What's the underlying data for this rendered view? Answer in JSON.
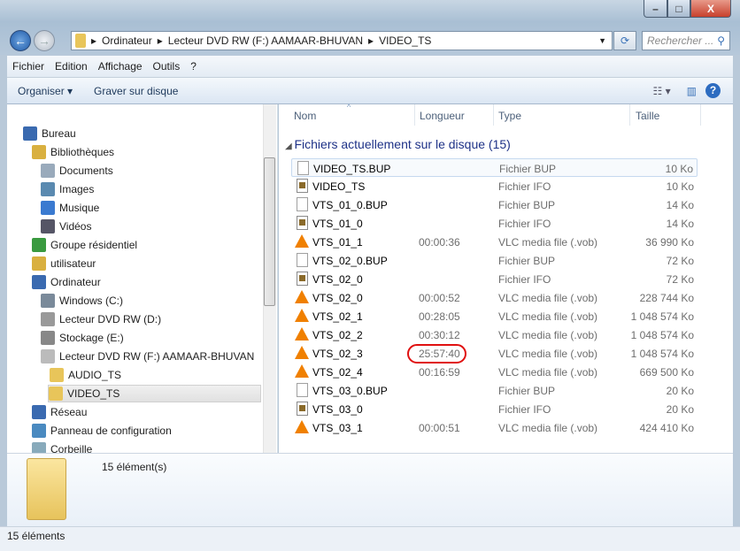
{
  "window": {
    "min": "–",
    "max": "□",
    "close": "X"
  },
  "address": {
    "crumbs": [
      "Ordinateur",
      "Lecteur DVD RW (F:) AAMAAR-BHUVAN",
      "VIDEO_TS"
    ],
    "search_placeholder": "Rechercher ..."
  },
  "menu": [
    "Fichier",
    "Edition",
    "Affichage",
    "Outils",
    "?"
  ],
  "toolbar": {
    "organize": "Organiser ▾",
    "burn": "Graver sur disque"
  },
  "nav": [
    {
      "label": "Bureau",
      "indent": 0,
      "color": "#3a6ab0"
    },
    {
      "label": "Bibliothèques",
      "indent": 1,
      "color": "#d9b040"
    },
    {
      "label": "Documents",
      "indent": 2,
      "color": "#9ab"
    },
    {
      "label": "Images",
      "indent": 2,
      "color": "#5a8ab0"
    },
    {
      "label": "Musique",
      "indent": 2,
      "color": "#3a7ad0"
    },
    {
      "label": "Vidéos",
      "indent": 2,
      "color": "#556"
    },
    {
      "label": "Groupe résidentiel",
      "indent": 1,
      "color": "#3a9a40"
    },
    {
      "label": "utilisateur",
      "indent": 1,
      "color": "#d9b040"
    },
    {
      "label": "Ordinateur",
      "indent": 1,
      "color": "#3a6ab0"
    },
    {
      "label": "Windows (C:)",
      "indent": 2,
      "color": "#7a8a9a"
    },
    {
      "label": "Lecteur DVD RW (D:)",
      "indent": 2,
      "color": "#999"
    },
    {
      "label": "Stockage (E:)",
      "indent": 2,
      "color": "#888"
    },
    {
      "label": "Lecteur DVD RW (F:) AAMAAR-BHUVAN",
      "indent": 2,
      "color": "#bbb"
    },
    {
      "label": "AUDIO_TS",
      "indent": 3,
      "color": "#e8c55a"
    },
    {
      "label": "VIDEO_TS",
      "indent": 3,
      "color": "#e8c55a",
      "selected": true
    },
    {
      "label": "Réseau",
      "indent": 1,
      "color": "#3a6ab0"
    },
    {
      "label": "Panneau de configuration",
      "indent": 1,
      "color": "#4a8ac0"
    },
    {
      "label": "Corbeille",
      "indent": 1,
      "color": "#8ab"
    }
  ],
  "columns": {
    "name": "Nom",
    "length": "Longueur",
    "type": "Type",
    "size": "Taille"
  },
  "group": "Fichiers actuellement sur le disque (15)",
  "files": [
    {
      "name": "VIDEO_TS.BUP",
      "length": "",
      "type": "Fichier BUP",
      "size": "10 Ko",
      "icon": "bup"
    },
    {
      "name": "VIDEO_TS",
      "length": "",
      "type": "Fichier IFO",
      "size": "10 Ko",
      "icon": "ifo"
    },
    {
      "name": "VTS_01_0.BUP",
      "length": "",
      "type": "Fichier BUP",
      "size": "14 Ko",
      "icon": "bup"
    },
    {
      "name": "VTS_01_0",
      "length": "",
      "type": "Fichier IFO",
      "size": "14 Ko",
      "icon": "ifo"
    },
    {
      "name": "VTS_01_1",
      "length": "00:00:36",
      "type": "VLC media file (.vob)",
      "size": "36 990 Ko",
      "icon": "vlc"
    },
    {
      "name": "VTS_02_0.BUP",
      "length": "",
      "type": "Fichier BUP",
      "size": "72 Ko",
      "icon": "bup"
    },
    {
      "name": "VTS_02_0",
      "length": "",
      "type": "Fichier IFO",
      "size": "72 Ko",
      "icon": "ifo"
    },
    {
      "name": "VTS_02_0",
      "length": "00:00:52",
      "type": "VLC media file (.vob)",
      "size": "228 744 Ko",
      "icon": "vlc"
    },
    {
      "name": "VTS_02_1",
      "length": "00:28:05",
      "type": "VLC media file (.vob)",
      "size": "1 048 574 Ko",
      "icon": "vlc"
    },
    {
      "name": "VTS_02_2",
      "length": "00:30:12",
      "type": "VLC media file (.vob)",
      "size": "1 048 574 Ko",
      "icon": "vlc"
    },
    {
      "name": "VTS_02_3",
      "length": "25:57:40",
      "type": "VLC media file (.vob)",
      "size": "1 048 574 Ko",
      "icon": "vlc"
    },
    {
      "name": "VTS_02_4",
      "length": "00:16:59",
      "type": "VLC media file (.vob)",
      "size": "669 500 Ko",
      "icon": "vlc"
    },
    {
      "name": "VTS_03_0.BUP",
      "length": "",
      "type": "Fichier BUP",
      "size": "20 Ko",
      "icon": "bup"
    },
    {
      "name": "VTS_03_0",
      "length": "",
      "type": "Fichier IFO",
      "size": "20 Ko",
      "icon": "ifo"
    },
    {
      "name": "VTS_03_1",
      "length": "00:00:51",
      "type": "VLC media file (.vob)",
      "size": "424 410 Ko",
      "icon": "vlc"
    }
  ],
  "details": {
    "count": "15 élément(s)"
  },
  "status": "15 éléments"
}
